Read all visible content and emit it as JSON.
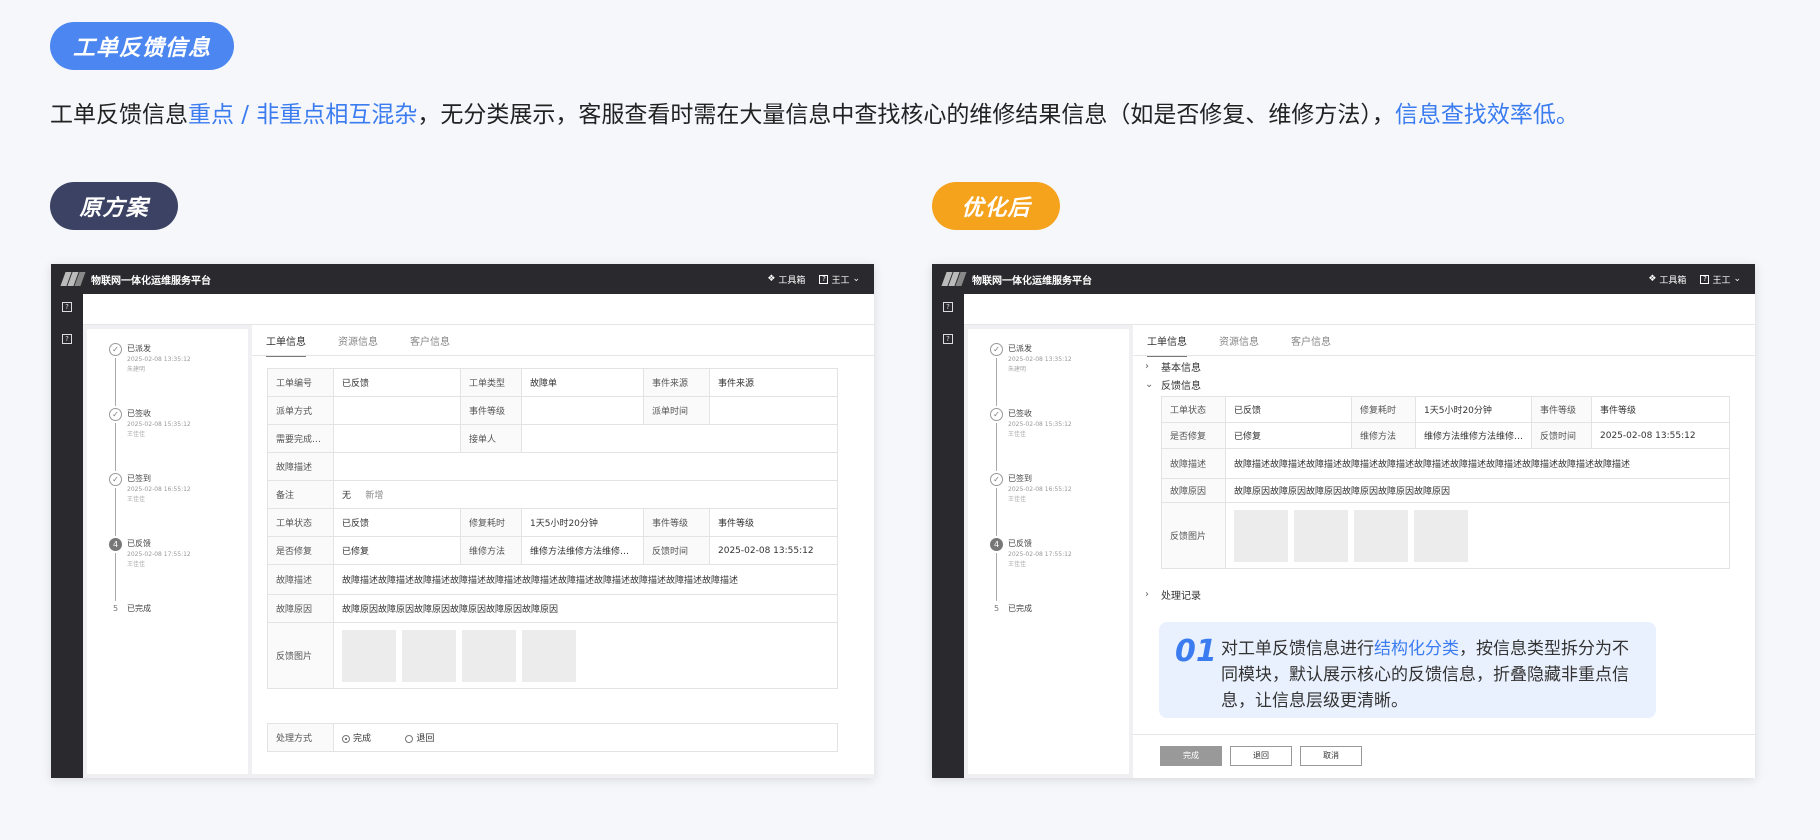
{
  "header": {
    "title_pill": "工单反馈信息",
    "intro": {
      "p1": "工单反馈信息",
      "h1": "重点 / 非重点相互混杂",
      "p2": "，无分类展示，客服查看时需在大量信息中查找核心的维修结果信息（如是否修复、维修方法），",
      "h2": "信息查找效率低。"
    },
    "orig_pill": "原方案",
    "opt_pill": "优化后"
  },
  "app": {
    "brand": "物联网一体化运维服务平台",
    "toolbox": "工具箱",
    "user": "王工"
  },
  "timeline": [
    {
      "num": "",
      "label": "已派发",
      "time": "2025-02-08 13:35:12",
      "op": "朱建明"
    },
    {
      "num": "",
      "label": "已签收",
      "time": "2025-02-08 15:35:12",
      "op": "王佳佳"
    },
    {
      "num": "",
      "label": "已签到",
      "time": "2025-02-08 16:55:12",
      "op": "王佳佳"
    },
    {
      "num": "4",
      "label": "已反馈",
      "time": "2025-02-08 17:55:12",
      "op": "王佳佳"
    },
    {
      "num": "5",
      "label": "已完成",
      "time": "",
      "op": ""
    }
  ],
  "tabs": [
    "工单信息",
    "资源信息",
    "客户信息"
  ],
  "left": {
    "rows": {
      "k_no": "工单编号",
      "v_no": "已反馈",
      "k_type": "工单类型",
      "v_type": "故障单",
      "k_src": "事件来源",
      "v_src": "事件来源",
      "k_dispatch": "派单方式",
      "k_level": "事件等级",
      "k_dtime": "派单时间",
      "k_need": "需要完成时间",
      "k_recv": "接单人",
      "k_desc": "故障描述",
      "k_note": "备注",
      "v_note": "无",
      "v_add": "新增",
      "k_status": "工单状态",
      "v_status": "已反馈",
      "k_cost": "修复耗时",
      "v_cost": "1天5小时20分钟",
      "k_lvl2": "事件等级",
      "v_lvl2": "事件等级",
      "k_fixed": "是否修复",
      "v_fixed": "已修复",
      "k_method": "维修方法",
      "v_method": "维修方法维修方法维修…",
      "k_fbtime": "反馈时间",
      "v_fbtime": "2025-02-08 13:55:12",
      "k_fdesc": "故障描述",
      "v_fdesc": "故障描述故障描述故障描述故障描述故障描述故障描述故障描述故障描述故障描述故障描述故障描述",
      "k_reason": "故障原因",
      "v_reason": "故障原因故障原因故障原因故障原因故障原因故障原因",
      "k_pic": "反馈图片",
      "k_handle": "处理方式",
      "v_done": "完成",
      "v_back": "退回"
    }
  },
  "right": {
    "sec_basic": "基本信息",
    "sec_feedback": "反馈信息",
    "sec_records": "处理记录",
    "rows": {
      "k_status": "工单状态",
      "v_status": "已反馈",
      "k_cost": "修复耗时",
      "v_cost": "1天5小时20分钟",
      "k_level": "事件等级",
      "v_level": "事件等级",
      "k_fixed": "是否修复",
      "v_fixed": "已修复",
      "k_method": "维修方法",
      "v_method": "维修方法维修方法维修…",
      "k_fbtime": "反馈时间",
      "v_fbtime": "2025-02-08 13:55:12",
      "k_fdesc": "故障描述",
      "v_fdesc": "故障描述故障描述故障描述故障描述故障描述故障描述故障描述故障描述故障描述故障描述故障描述",
      "k_reason": "故障原因",
      "v_reason": "故障原因故障原因故障原因故障原因故障原因故障原因",
      "k_pic": "反馈图片"
    },
    "callout": {
      "num": "01",
      "t1": "对工单反馈信息进行",
      "hl": "结构化分类",
      "t2": "，按信息类型拆分为不同模块，默认展示核心的反馈信息，折叠隐藏非重点信息，让信息层级更清晰。"
    },
    "buttons": {
      "done": "完成",
      "back": "退回",
      "cancel": "取消"
    }
  }
}
